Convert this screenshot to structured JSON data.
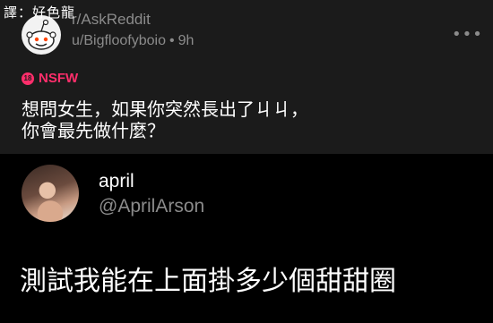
{
  "translator_tag": "譯：好色龍",
  "reddit_post": {
    "subreddit": "r/AskReddit",
    "author": "u/Bigfloofyboio",
    "separator": "•",
    "age": "9h",
    "more_icon": "more-horizontal-icon",
    "nsfw_icon_text": "18",
    "nsfw_label": "NSFW",
    "title_lines": [
      "想問女生，如果你突然長出了ㄐㄐ，",
      "你會最先做什麼？"
    ]
  },
  "tweet": {
    "name": "april",
    "handle": "@AprilArson",
    "text": "測試我能在上面掛多少個甜甜圈"
  },
  "colors": {
    "reddit_bg": "#1b1b1b",
    "tweet_bg": "#000000",
    "nsfw": "#ff2e6b",
    "meta_gray": "#8b8b8b"
  }
}
